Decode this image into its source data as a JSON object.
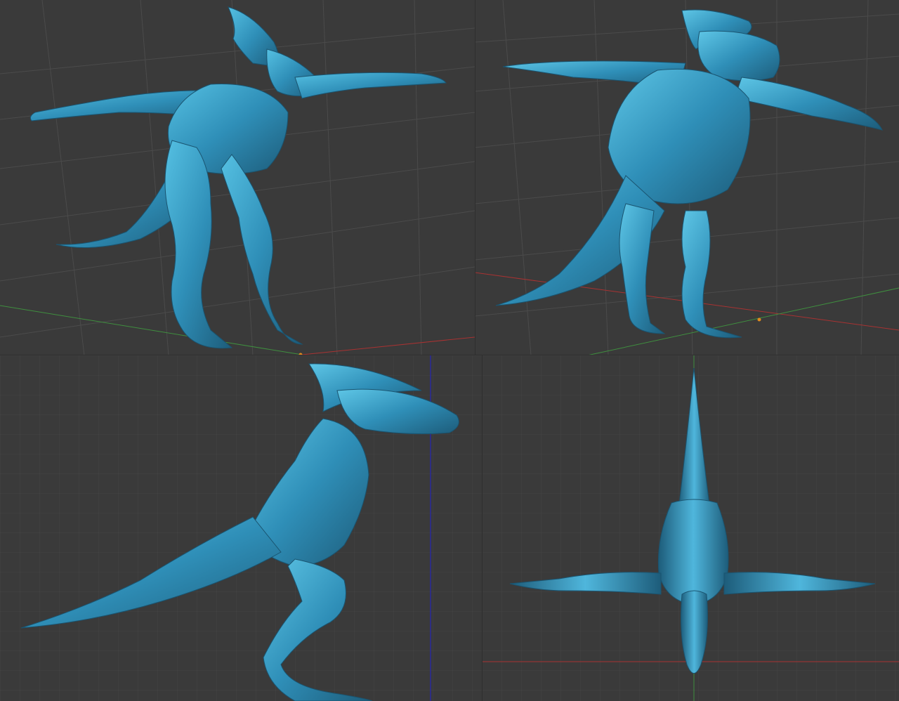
{
  "window": {
    "background": "#3a3a3a"
  },
  "theme": {
    "model_color": "#2f8fb8",
    "model_highlight": "#5ec6e6",
    "model_shadow": "#1d5c7a",
    "grid_color": "#4a4a4a",
    "axis_x_color": "#a83232",
    "axis_y_color": "#3f8f3f",
    "axis_z_color": "#2b2b9a",
    "origin_color": "#e08a1e"
  },
  "viewports": [
    {
      "id": "perspective-front-left",
      "view": "perspective",
      "model": "lizard-humanoid-tpose"
    },
    {
      "id": "perspective-back-right",
      "view": "perspective",
      "model": "lizard-humanoid-tpose"
    },
    {
      "id": "orthographic-side",
      "view": "orthographic",
      "model": "lizard-humanoid-tpose"
    },
    {
      "id": "orthographic-top",
      "view": "orthographic",
      "model": "lizard-humanoid-tpose"
    }
  ]
}
